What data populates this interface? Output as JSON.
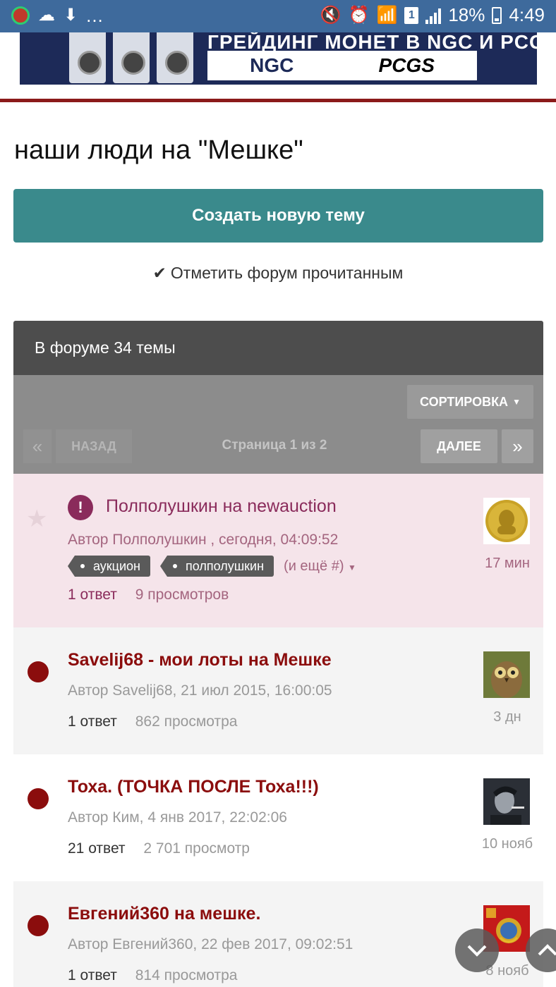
{
  "status_bar": {
    "battery": "18%",
    "time": "4:49",
    "sim_badge": "1",
    "more_dots": "..."
  },
  "banner": {
    "title": "ГРЕЙДИНГ МОНЕТ В NGC И PCGS",
    "logo_ngc": "NGC",
    "logo_pcgs": "PCGS"
  },
  "page": {
    "title": "наши люди на \"Мешке\"",
    "create_button": "Создать новую тему",
    "mark_read": "Отметить форум прочитанным"
  },
  "forum": {
    "header": "В форуме 34 темы",
    "sort_label": "СОРТИРОВКА",
    "pagination": {
      "first": "«",
      "prev": "НАЗАД",
      "info": "Страница 1 из 2",
      "next": "ДАЛЕЕ",
      "last": "»"
    },
    "topics": [
      {
        "title": "Полполушкин на newauction",
        "author_line": "Автор Полполушкин , сегодня, 04:09:52",
        "tags": [
          "аукцион",
          "полполушкин"
        ],
        "tags_more": "(и ещё #)",
        "replies": "1 ответ",
        "views": "9 просмотров",
        "time": "17 мин",
        "avatar": "gold-coin"
      },
      {
        "title": "Savelij68 - мои лоты на Мешке",
        "author_line": "Автор Savelij68, 21 июл 2015, 16:00:05",
        "replies": "1 ответ",
        "views": "862 просмотра",
        "time": "3 дн",
        "avatar": "owl"
      },
      {
        "title": "Тоха. (ТОЧКА ПОСЛЕ Тоха!!!)",
        "author_line": "Автор Ким, 4 янв 2017, 22:02:06",
        "replies": "21 ответ",
        "views": "2 701 просмотр",
        "time": "10 нояб",
        "avatar": "portrait"
      },
      {
        "title": "Евгений360 на мешке.",
        "author_line": "Автор Евгений360, 22 фев 2017, 09:02:51",
        "replies": "1 ответ",
        "views": "814 просмотра",
        "time": "8 нояб",
        "avatar": "ussr-emblem"
      }
    ]
  },
  "colors": {
    "status_bar": "#3e6a9c",
    "accent_teal": "#3a8a8c",
    "topic_title": "#8b0d0d",
    "pinned_title": "#8a2b5b",
    "pinned_bg": "#f5e4ea"
  }
}
